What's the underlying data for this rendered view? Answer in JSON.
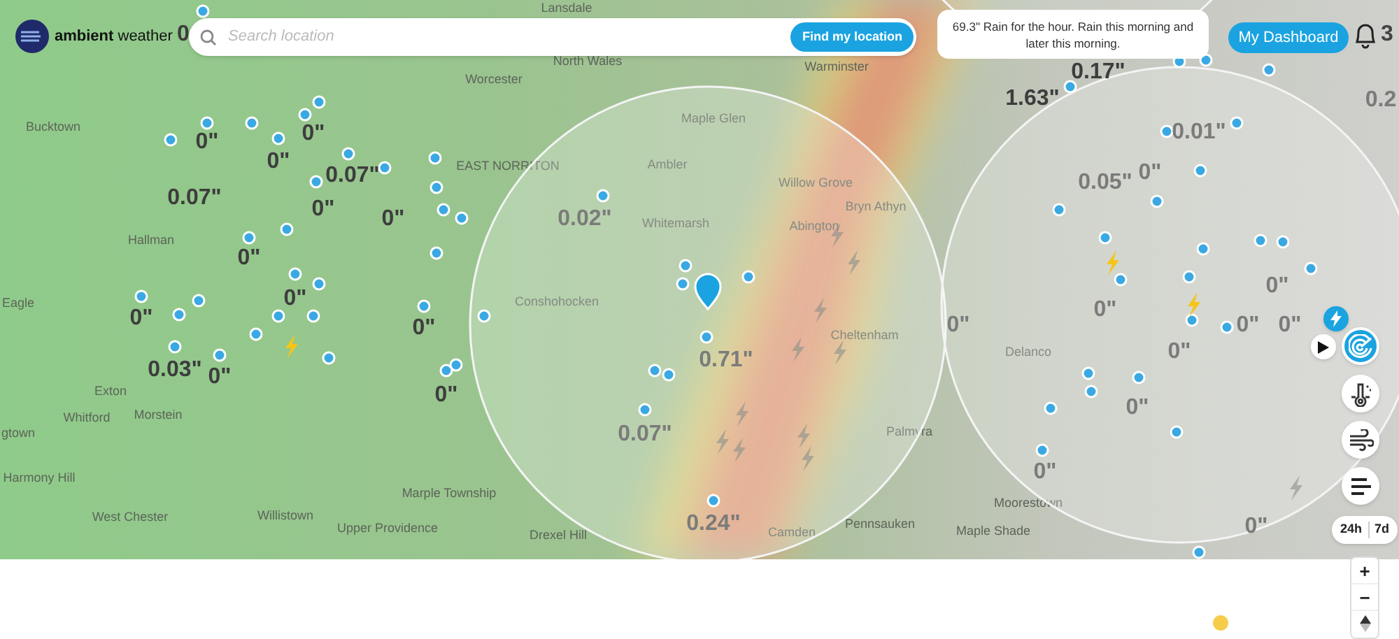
{
  "header": {
    "logo_text": "**ambient** weather",
    "search": {
      "placeholder": "Search location"
    },
    "find_button": "Find my location",
    "forecast": "69.3\" Rain for the hour. Rain this morning and later this morning.",
    "dashboard_button": "My Dashboard",
    "bell_count": "3"
  },
  "map": {
    "places": [
      "Lansdale",
      "North Wales",
      "Worcester",
      "Warminster",
      "Maple Glen",
      "Ambler",
      "EAST NORRITON",
      "Bucktown",
      "Hallman",
      "Eagle",
      "Exton",
      "Whitford",
      "Morstein",
      "gtown",
      "Harmony Hill",
      "West Chester",
      "Willistown",
      "Upper Providence",
      "Marple Township",
      "Drexel Hill",
      "Camden",
      "Conshohocken",
      "Whitemarsh",
      "Willow Grove",
      "Abington",
      "Bryn Athyn",
      "Cheltenham",
      "Palmyra",
      "Delanco",
      "Moorestown",
      "Maple Shade",
      "Pennsauken"
    ],
    "readings": [
      "0",
      "0\"",
      "0\"",
      "0\"",
      "0.07\"",
      "0.07\"",
      "0\"",
      "0\"",
      "0\"",
      "0\"",
      "0\"",
      "0.03\"",
      "0\"",
      "0\"",
      "0\"",
      "0.02\"",
      "0.71\"",
      "0.07\"",
      "0.24\"",
      "1.63\"",
      "0.17\"",
      "0.01\"",
      "0.05\"",
      "0\"",
      "0\"",
      "0\"",
      "0\"",
      "0\"",
      "0\"",
      "0\"",
      "0\"",
      "0\"",
      "0\"",
      "0.2"
    ],
    "layers": [
      {
        "kind": "lightning",
        "selected": true
      },
      {
        "kind": "play",
        "selected": false
      },
      {
        "kind": "radar",
        "selected": true
      },
      {
        "kind": "temperature",
        "selected": false
      },
      {
        "kind": "wind",
        "selected": false
      },
      {
        "kind": "list",
        "selected": false
      }
    ],
    "ranges": [
      "24h",
      "7d"
    ],
    "zoom": [
      "+",
      "−"
    ]
  }
}
